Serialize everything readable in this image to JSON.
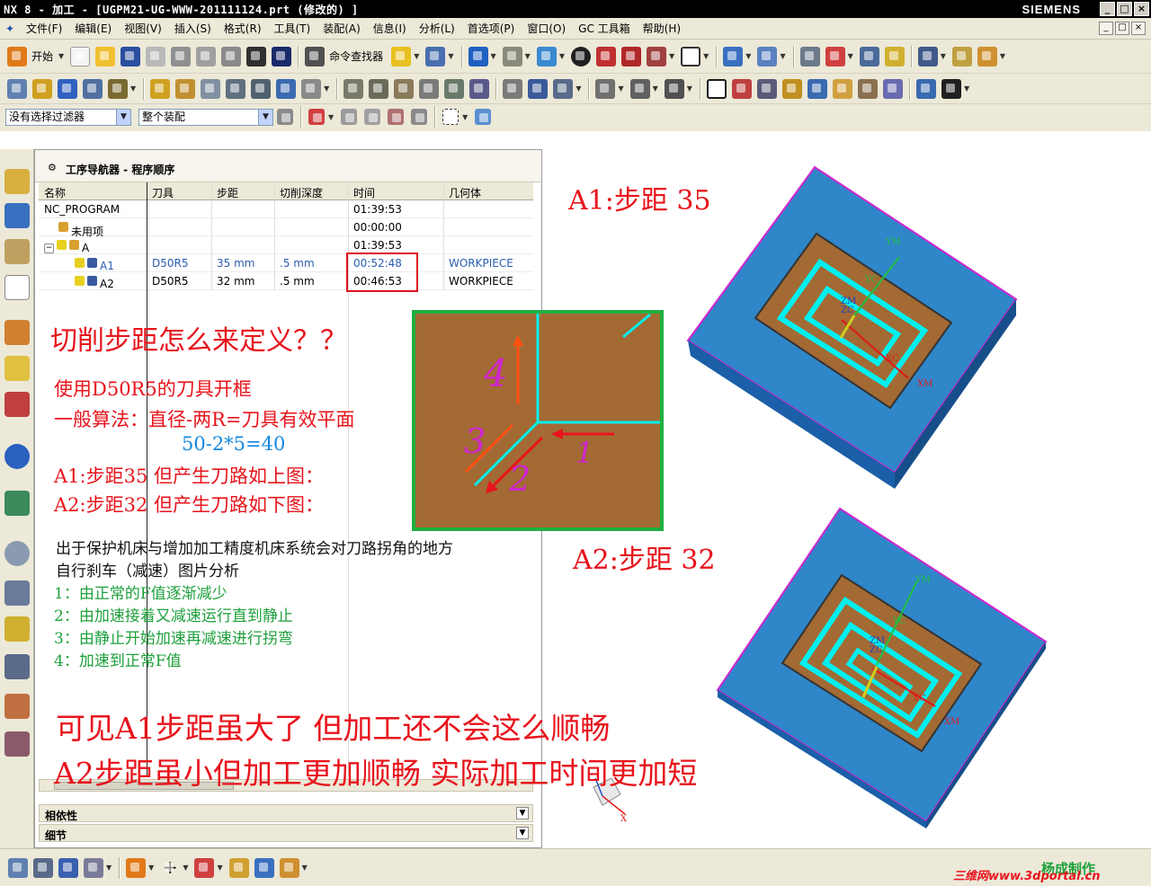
{
  "window": {
    "title": "NX 8 - 加工 - [UGPM21-UG-WWW-201111124.prt  (修改的) ]",
    "brand": "SIEMENS",
    "minimize": "_",
    "maximize": "□",
    "close": "×"
  },
  "menu": {
    "items": [
      "文件(F)",
      "编辑(E)",
      "视图(V)",
      "插入(S)",
      "格式(R)",
      "工具(T)",
      "装配(A)",
      "信息(I)",
      "分析(L)",
      "首选项(P)",
      "窗口(O)",
      "GC 工具箱",
      "帮助(H)"
    ]
  },
  "toolbar": {
    "start_label": "开始",
    "command_finder_label": "命令查找器",
    "filter_combo": "没有选择过滤器",
    "scope_combo": "整个装配"
  },
  "navigator": {
    "title": "工序导航器 - 程序顺序",
    "columns": [
      "名称",
      "刀具",
      "步距",
      "切削深度",
      "时间",
      "几何体"
    ],
    "rows": [
      {
        "name": "NC_PROGRAM",
        "tool": "",
        "stepover": "",
        "depth": "",
        "time": "01:39:53",
        "geometry": ""
      },
      {
        "name": "未用项",
        "tool": "",
        "stepover": "",
        "depth": "",
        "time": "00:00:00",
        "geometry": ""
      },
      {
        "name": "A",
        "tool": "",
        "stepover": "",
        "depth": "",
        "time": "01:39:53",
        "geometry": ""
      },
      {
        "name": "A1",
        "tool": "D50R5",
        "stepover": "35 mm",
        "depth": ".5 mm",
        "time": "00:52:48",
        "geometry": "WORKPIECE"
      },
      {
        "name": "A2",
        "tool": "D50R5",
        "stepover": "32 mm",
        "depth": ".5 mm",
        "time": "00:46:53",
        "geometry": "WORKPIECE"
      }
    ],
    "dependency_label": "相依性",
    "details_label": "细节"
  },
  "annotations": {
    "question": "切削步距怎么来定义？？",
    "tool_line": "使用D50R5的刀具开框",
    "formula_line": "一般算法：直径-两R=刀具有效平面",
    "calc": "50-2*5=40",
    "a1_line": "A1:步距35   但产生刀路如上图：",
    "a2_line": "A2:步距32   但产生刀路如下图：",
    "reason_1": "出于保护机床与增加加工精度机床系统会对刀路拐角的地方",
    "reason_2": "自行刹车（减速）图片分析",
    "step_1": "1：由正常的F值逐渐减少",
    "step_2": "2：由加速接着又减速运行直到静止",
    "step_3": "3：由静止开始加速再减速进行拐弯",
    "step_4": "4：加速到正常F值",
    "conclusion_1": "可见A1步距虽大了  但加工还不会这么顺畅",
    "conclusion_2": "A2步距虽小但加工更加顺畅  实际加工时间更加短",
    "a1_caption": "A1:步距 35",
    "a2_caption": "A2:步距 32",
    "diagram_labels": [
      "1",
      "2",
      "3",
      "4"
    ]
  },
  "model_labels": {
    "ym": "YM",
    "zm": "ZM",
    "zc": "ZC",
    "yc": "YC",
    "xc": "XC",
    "xm": "XM",
    "x": "X"
  },
  "watermark": {
    "author": "杨成制作",
    "site": "三维网www.3dportal.cn"
  }
}
